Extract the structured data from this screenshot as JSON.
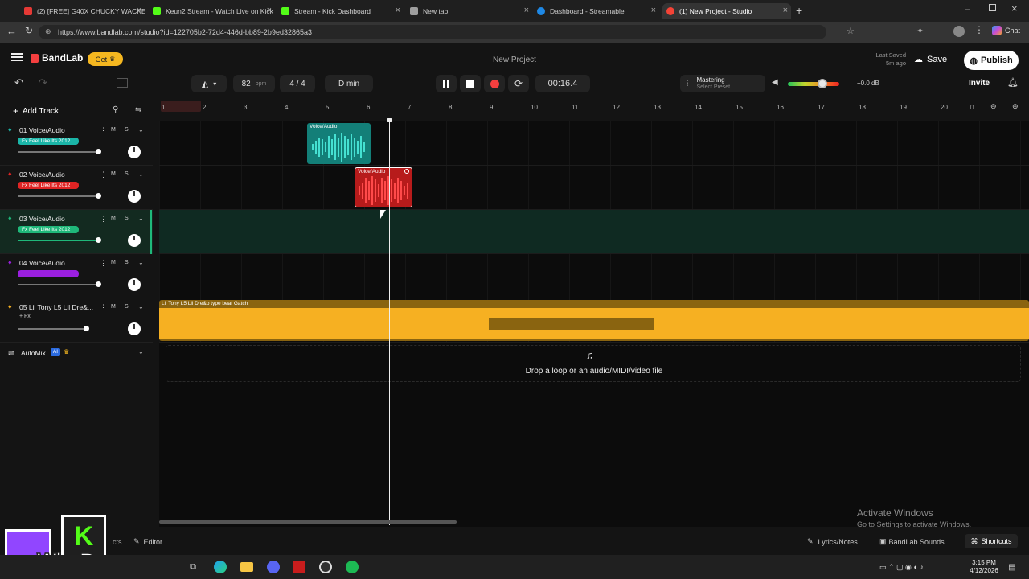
{
  "browser": {
    "tabs": [
      {
        "label": "(2) [FREE] G40X CHUCKY WACKE",
        "color": "#e53935"
      },
      {
        "label": "Keun2 Stream - Watch Live on Kick",
        "color": "#53fc18"
      },
      {
        "label": "Stream - Kick Dashboard",
        "color": "#53fc18"
      },
      {
        "label": "New tab",
        "color": "#9e9e9e"
      },
      {
        "label": "Dashboard - Streamable",
        "color": "#1e88e5"
      },
      {
        "label": "(1) New Project - Studio",
        "color": "#f44336"
      }
    ],
    "url": "https://www.bandlab.com/studio?id=122705b2-72d4-446d-bb89-2b9ed32865a3",
    "chat_label": "Chat"
  },
  "app": {
    "brand": "BandLab",
    "get_label": "Get",
    "project_title": "New Project",
    "last_saved_label": "Last Saved",
    "last_saved_value": "5m ago",
    "save_label": "Save",
    "publish_label": "Publish",
    "invite_label": "Invite"
  },
  "transport": {
    "bpm_value": "82",
    "bpm_unit": "bpm",
    "time_sig": "4 / 4",
    "key": "D min",
    "time": "00:16.4",
    "mastering_label": "Mastering",
    "mastering_preset": "Select Preset",
    "master_db": "+0.0 dB"
  },
  "tracks_panel": {
    "add_track_label": "Add Track",
    "automix_label": "AutoMix",
    "automix_badge": "AI"
  },
  "tracks": [
    {
      "name": "01 Voice/Audio",
      "fx": "Fx Feel Like Its 2012",
      "color": "#1bb5a8"
    },
    {
      "name": "02 Voice/Audio",
      "fx": "Fx Feel Like Its 2012",
      "color": "#e02424"
    },
    {
      "name": "03 Voice/Audio",
      "fx": "Fx Feel Like Its 2012",
      "color": "#1fb87a"
    },
    {
      "name": "04 Voice/Audio",
      "fx": "",
      "color": "#9b1fe0"
    },
    {
      "name": "05 Lil Tony L5 Lil Dre&...",
      "fx": "+ Fx",
      "color": "#f6b022"
    }
  ],
  "ruler": [
    "1",
    "2",
    "3",
    "4",
    "5",
    "6",
    "7",
    "8",
    "9",
    "10",
    "11",
    "12",
    "13",
    "14",
    "15",
    "16",
    "17",
    "18",
    "19",
    "20"
  ],
  "clips": {
    "clip1": "Voice/Audio",
    "clip2": "Voice/Audio",
    "beat": "Lil Tony L5 Lil Dre&o type beat Gatch"
  },
  "drop_hint": "Drop a loop or an audio/MIDI/video file",
  "watermark": {
    "title": "Activate Windows",
    "subtitle": "Go to Settings to activate Windows."
  },
  "statusbar": {
    "editor_label": "Editor",
    "left_partial": "cts",
    "lyrics_label": "Lyrics/Notes",
    "sounds_label": "BandLab Sounds",
    "shortcuts_label": "Shortcuts"
  },
  "overlay_text": "WhoBuccss",
  "taskbar": {
    "time": "3:15 PM",
    "date": "4/12/2026"
  }
}
